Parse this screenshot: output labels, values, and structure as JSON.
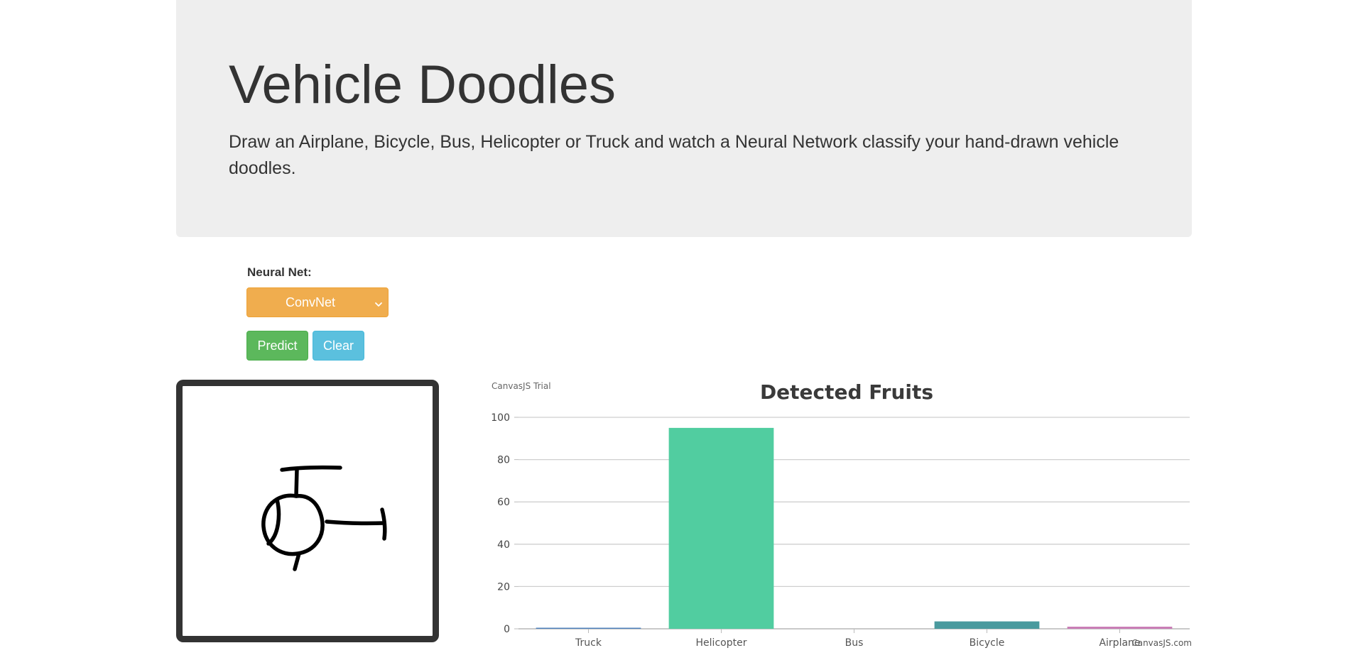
{
  "header": {
    "title": "Vehicle Doodles",
    "subtitle": "Draw an Airplane, Bicycle, Bus, Helicopter or Truck and watch a Neural Network classify your hand-drawn vehicle doodles."
  },
  "controls": {
    "neural_net_label": "Neural Net:",
    "selected_model": "ConvNet",
    "predict_label": "Predict",
    "clear_label": "Clear"
  },
  "colors": {
    "jumbotron": "#eeeeee",
    "select": "#f0ad4e",
    "predict": "#5cb85c",
    "clear": "#5bc0de"
  },
  "icons": {
    "select_arrow": "chevron-down-icon"
  },
  "drawing": {
    "subject": "helicopter doodle"
  },
  "chart_watermark": {
    "trial": "CanvasJS Trial",
    "credit": "CanvasJS.com"
  },
  "chart_data": {
    "type": "bar",
    "title": "Detected Fruits",
    "categories": [
      "Truck",
      "Helicopter",
      "Bus",
      "Bicycle",
      "Airplane"
    ],
    "values": [
      0.3,
      95,
      0,
      3.5,
      1
    ],
    "colors": [
      "#4f81bc",
      "#51cda0",
      "#c0504e",
      "#4a9a9e",
      "#c97db6"
    ],
    "ylim": [
      0,
      100
    ],
    "yticks": [
      0,
      20,
      40,
      60,
      80,
      100
    ],
    "grid": true,
    "xlabel": "",
    "ylabel": ""
  }
}
